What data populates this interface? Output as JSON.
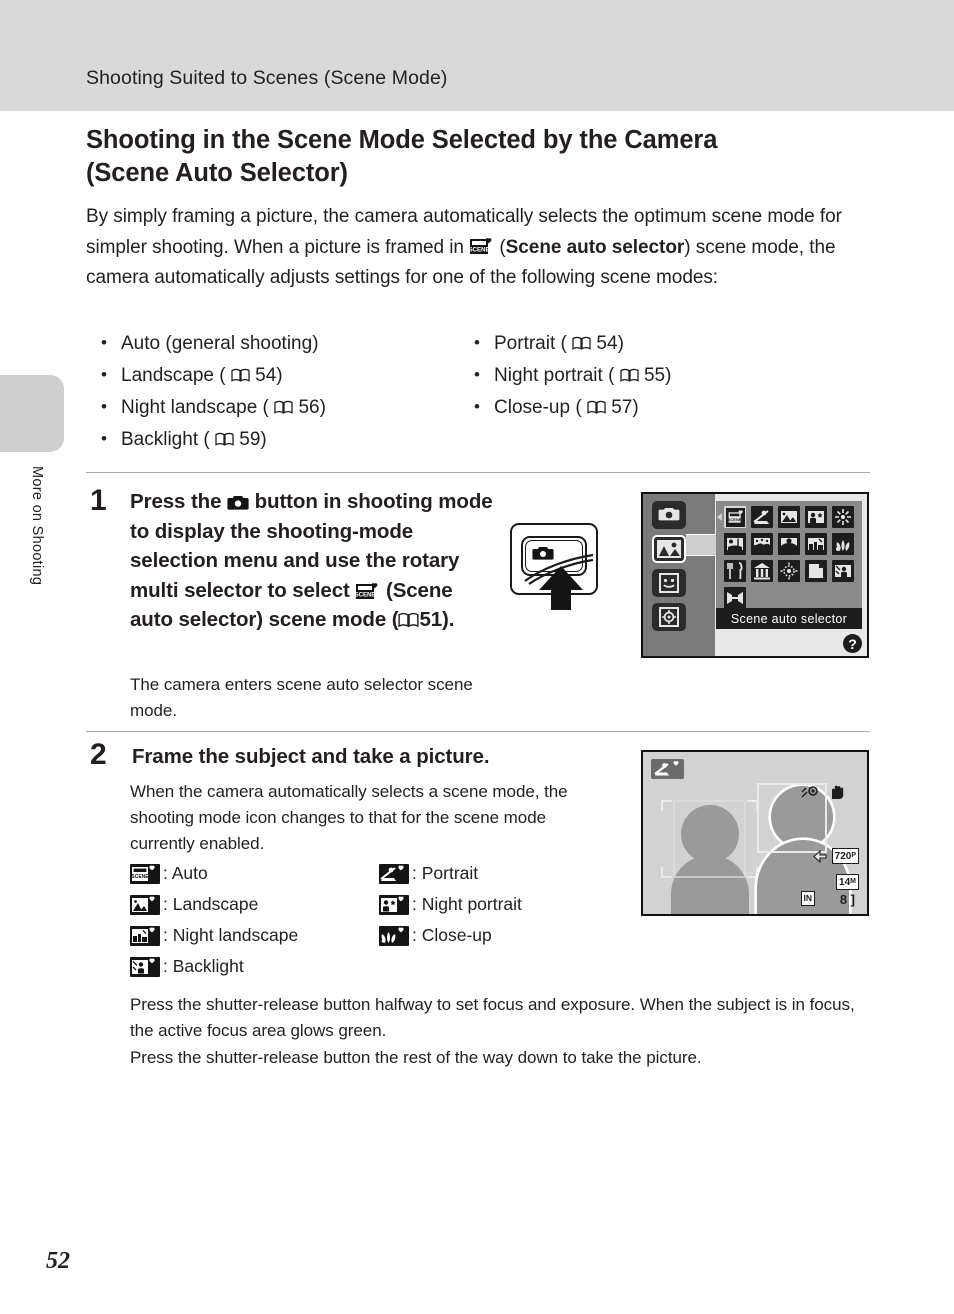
{
  "header": {
    "running_title": "Shooting Suited to Scenes (Scene Mode)"
  },
  "thumb_tab": {
    "label": "More on Shooting"
  },
  "section": {
    "title_line1": "Shooting in the Scene Mode Selected by the Camera",
    "title_line2": "(Scene Auto Selector)"
  },
  "intro": {
    "part1": "By simply framing a picture, the camera automatically selects the optimum scene mode for simpler shooting. When a picture is framed in ",
    "icon": "scene-auto-selector-icon",
    "bold": "Scene auto selector",
    "part2": ") scene mode, the camera automatically adjusts settings for one of the following scene modes:"
  },
  "mode_list": {
    "left": [
      {
        "text": "Auto (general shooting)",
        "page": ""
      },
      {
        "text": "Landscape",
        "page": "54"
      },
      {
        "text": "Night landscape",
        "page": "56"
      },
      {
        "text": "Backlight",
        "page": "59"
      }
    ],
    "right": [
      {
        "text": "Portrait",
        "page": "54"
      },
      {
        "text": "Night portrait",
        "page": "55"
      },
      {
        "text": "Close-up",
        "page": "57"
      }
    ]
  },
  "steps": [
    {
      "number": "1",
      "heading_part1": "Press the ",
      "heading_part2": " button in shooting mode to display the shooting-mode selection menu and use the rotary multi selector to select ",
      "heading_bold": "Scene auto selector",
      "heading_part3": ") scene mode (",
      "heading_page": "51",
      "heading_part4": ").",
      "body": "The camera enters scene auto selector scene mode."
    },
    {
      "number": "2",
      "heading": "Frame the subject and take a picture.",
      "body": "When the camera automatically selects a scene mode, the shooting mode icon changes to that for the scene mode currently enabled."
    }
  ],
  "icon_legend": {
    "left": [
      {
        "icon": "scene-auto-icon",
        "label": ": Auto"
      },
      {
        "icon": "landscape-icon",
        "label": ": Landscape"
      },
      {
        "icon": "night-landscape-icon",
        "label": ": Night landscape"
      },
      {
        "icon": "backlight-icon",
        "label": ": Backlight"
      }
    ],
    "right": [
      {
        "icon": "portrait-icon",
        "label": ": Portrait"
      },
      {
        "icon": "night-portrait-icon",
        "label": ": Night portrait"
      },
      {
        "icon": "close-up-icon",
        "label": ": Close-up"
      }
    ]
  },
  "paragraphs": {
    "p1": "Press the shutter-release button halfway to set focus and exposure. When the subject is in focus, the active focus area glows green.",
    "p2": "Press the shutter-release button the rest of the way down to take the picture."
  },
  "figure_menu": {
    "selected_label": "Scene auto selector",
    "help_badge": "?",
    "mode_sidebar": [
      "auto-mode-icon",
      "scene-mode-icon",
      "smart-portrait-icon",
      "subject-tracking-icon"
    ],
    "scene_grid": [
      "scene-auto-selector-icon",
      "portrait-icon",
      "landscape-icon",
      "night-portrait-icon",
      "party-indoor-icon",
      "beach-icon",
      "snow-icon",
      "sunset-icon",
      "dusk-dawn-icon",
      "close-up-icon",
      "food-icon",
      "museum-icon",
      "fireworks-icon",
      "copy-icon",
      "backlight-icon",
      "panorama-icon"
    ]
  },
  "figure_liveview": {
    "mode_tag_icon": "portrait-icon",
    "movie_badge": "720",
    "movie_badge_suffix": "P",
    "image_size_badge": "14",
    "image_size_suffix": "M",
    "memory_badge": "IN",
    "shots_remaining": "8 ]",
    "shots_prefix": "["
  },
  "page_number": "52",
  "colors": {
    "header_band": "#d9d9d9",
    "tab": "#cfcfcf",
    "rule": "#a9a9a9",
    "text": "#231f20",
    "lcd_dark": "#1d1d1d"
  }
}
